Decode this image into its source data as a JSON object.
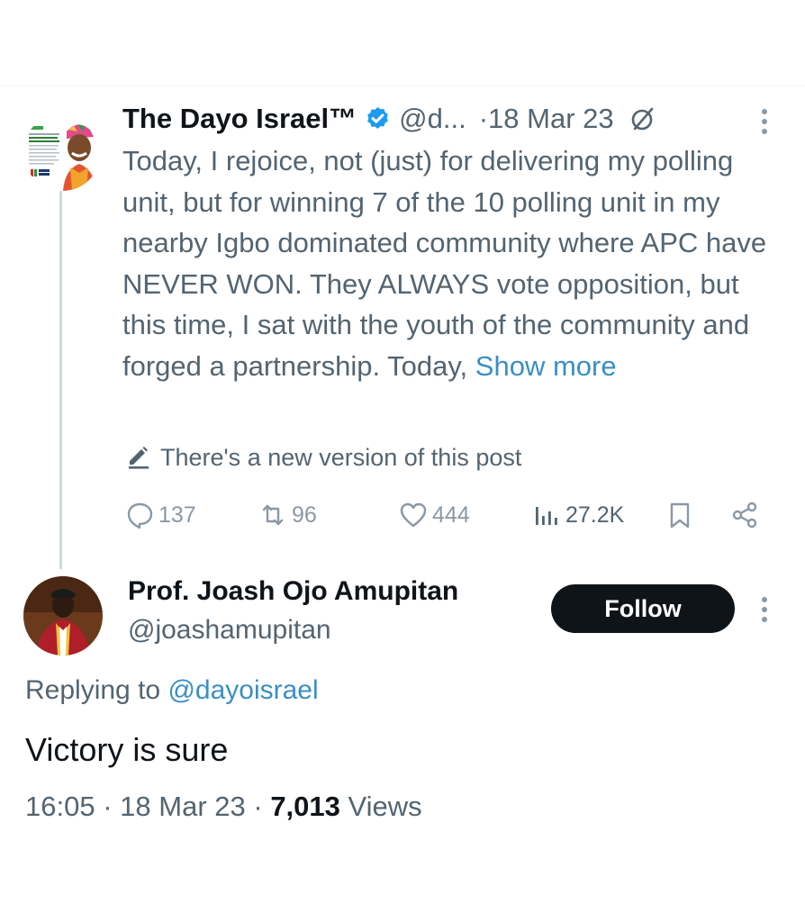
{
  "parent_tweet": {
    "name": "The Dayo Israel™",
    "handle": "@d...",
    "separator": "·",
    "date": "18 Mar 23",
    "text": "Today, I rejoice, not (just) for delivering my polling unit, but for winning 7 of the 10 polling unit in my nearby Igbo dominated community where APC have NEVER WON. They ALWAYS vote opposition, but this time, I sat with the youth of the community and forged a partnership. Today,",
    "show_more": "Show more",
    "new_version_notice": "There's a new version of this post",
    "actions": {
      "replies": "137",
      "reposts": "96",
      "likes": "444",
      "views": "27.2K"
    },
    "icons": {
      "verified": "verified-badge-icon",
      "edited": "edit-history-icon",
      "more": "more-vertical-icon",
      "pencil": "pencil-icon",
      "reply": "reply-icon",
      "repost": "repost-icon",
      "like": "heart-icon",
      "views": "views-bar-chart-icon",
      "bookmark": "bookmark-icon",
      "share": "share-icon"
    }
  },
  "reply_tweet": {
    "name": "Prof. Joash Ojo Amupitan",
    "handle": "@joashamupitan",
    "follow_label": "Follow",
    "replying_to_prefix": "Replying to",
    "replying_to_handle": "@dayoisrael",
    "text": "Victory is sure",
    "time": "16:05",
    "date": "18 Mar 23",
    "views_count": "7,013",
    "views_label": "Views"
  },
  "colors": {
    "text_primary": "#0f1419",
    "text_secondary": "#536471",
    "link": "#3b8fc2",
    "verified": "#1d9bf0",
    "follow_button": "#0f1419"
  }
}
